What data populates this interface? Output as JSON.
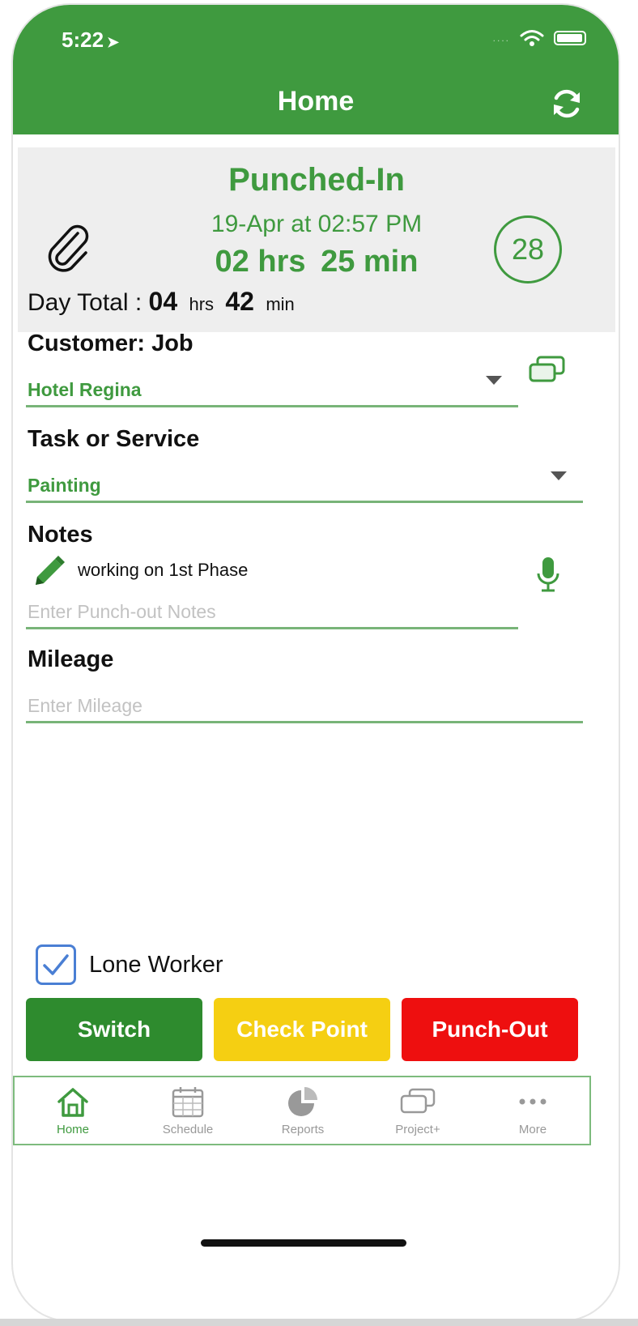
{
  "status_bar": {
    "time": "5:22",
    "location_glyph": "➤",
    "dots": "....",
    "icons": [
      "wifi-icon",
      "battery-icon"
    ]
  },
  "header": {
    "title": "Home",
    "refresh_icon": "refresh-icon"
  },
  "punch": {
    "status": "Punched-In",
    "datetime": "19-Apr at 02:57 PM",
    "hours": "02 hrs",
    "minutes": "25 min",
    "counter": "28",
    "day_total_label": "Day Total :",
    "day_total_hours": "04",
    "hrs_unit": "hrs",
    "day_total_minutes": "42",
    "min_unit": "min"
  },
  "form": {
    "customer_label": "Customer: Job",
    "customer_value": "Hotel Regina",
    "task_label": "Task or Service",
    "task_value": "Painting",
    "notes_label": "Notes",
    "notes_text": "working on 1st Phase",
    "notes_placeholder": "Enter Punch-out Notes",
    "mileage_label": "Mileage",
    "mileage_placeholder": "Enter Mileage"
  },
  "lone_worker": {
    "label": "Lone Worker",
    "checked": true
  },
  "actions": {
    "switch": "Switch",
    "check_point": "Check Point",
    "punch_out": "Punch-Out"
  },
  "colors": {
    "brand_green": "#3f9a3f",
    "switch": "#2e8b2e",
    "check_point": "#f5cf12",
    "punch_out": "#ee0f0f",
    "checkbox": "#4a7fd4"
  },
  "tabs": [
    {
      "label": "Home",
      "icon": "home-icon",
      "active": true
    },
    {
      "label": "Schedule",
      "icon": "calendar-icon",
      "active": false
    },
    {
      "label": "Reports",
      "icon": "pie-chart-icon",
      "active": false
    },
    {
      "label": "Project+",
      "icon": "chat-bubbles-icon",
      "active": false
    },
    {
      "label": "More",
      "icon": "more-icon",
      "active": false
    }
  ]
}
